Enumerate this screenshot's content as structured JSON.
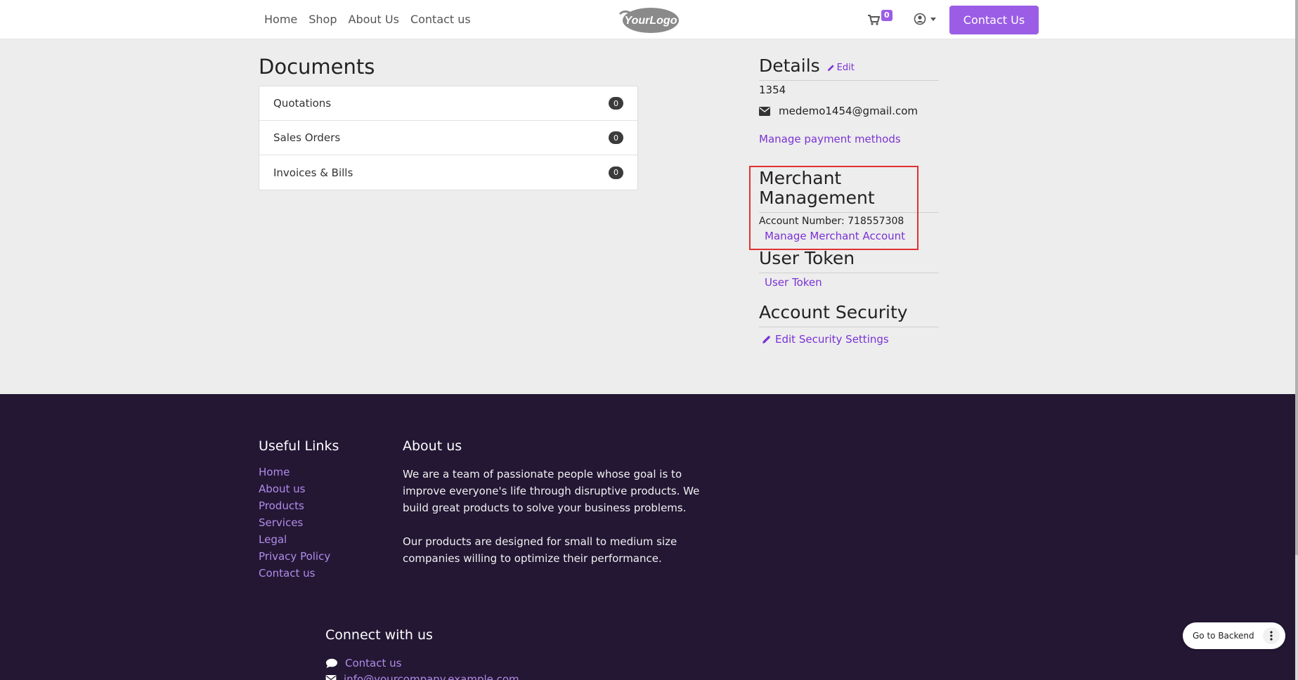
{
  "header": {
    "nav": [
      "Home",
      "Shop",
      "About Us",
      "Contact us"
    ],
    "logo_text": "YourLogo",
    "cart_count": "0",
    "contact_button": "Contact Us"
  },
  "documents": {
    "title": "Documents",
    "items": [
      {
        "label": "Quotations",
        "count": "0"
      },
      {
        "label": "Sales Orders",
        "count": "0"
      },
      {
        "label": "Invoices & Bills",
        "count": "0"
      }
    ]
  },
  "details": {
    "title": "Details",
    "edit_label": "Edit",
    "id_value": "1354",
    "email": "medemo1454@gmail.com",
    "manage_payment": "Manage payment methods"
  },
  "merchant": {
    "title": "Merchant Management",
    "account_number": "Account Number: 718557308",
    "manage_link": "Manage Merchant Account"
  },
  "user_token": {
    "title": "User Token",
    "link": "User Token"
  },
  "security": {
    "title": "Account Security",
    "link": "Edit Security Settings"
  },
  "footer": {
    "useful_links_title": "Useful Links",
    "useful_links": [
      "Home",
      "About us",
      "Products",
      "Services",
      "Legal",
      "Privacy Policy",
      "Contact us"
    ],
    "about_title": "About us",
    "about_p1": "We are a team of passionate people whose goal is to improve everyone's life through disruptive products. We build great products to solve your business problems.",
    "about_p2": "Our products are designed for small to medium size companies willing to optimize their performance.",
    "connect_title": "Connect with us",
    "contact_link": "Contact us",
    "email_link": "info@yourcompany.example.com"
  },
  "backend_button": "Go to Backend",
  "colors": {
    "accent": "#9b5de5",
    "link": "#7a32d4",
    "footer_bg": "#231734",
    "highlight": "#e03131"
  }
}
